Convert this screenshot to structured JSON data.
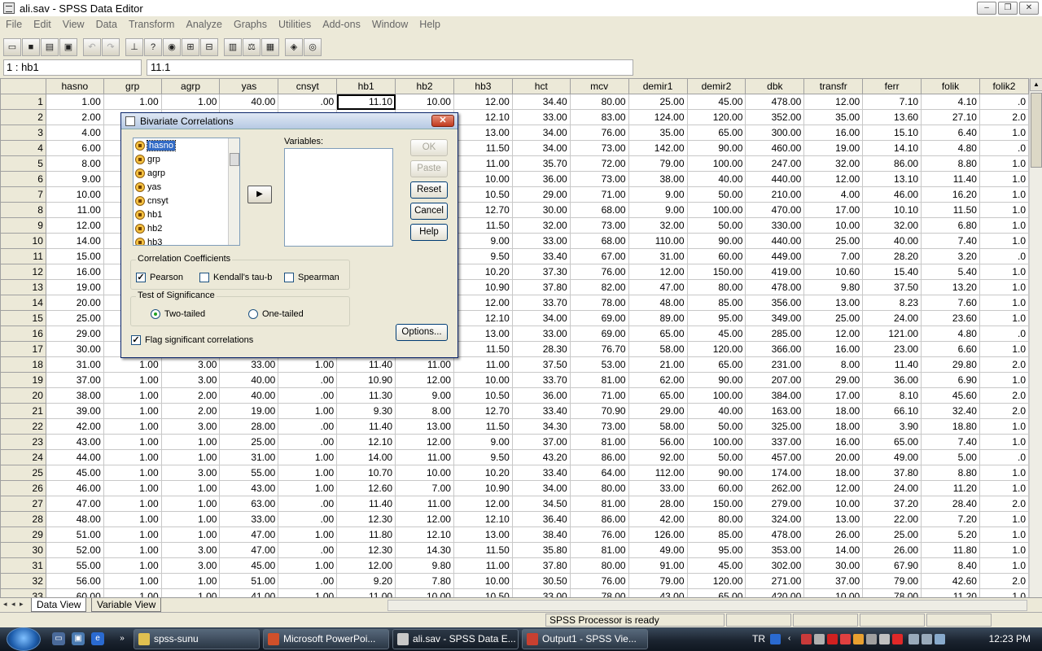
{
  "window": {
    "title": "ali.sav - SPSS Data Editor",
    "buttons": [
      "–",
      "❐",
      "✕"
    ]
  },
  "menu": [
    "File",
    "Edit",
    "View",
    "Data",
    "Transform",
    "Analyze",
    "Graphs",
    "Utilities",
    "Add-ons",
    "Window",
    "Help"
  ],
  "toolbar": {
    "icons": [
      "open-icon",
      "save-icon",
      "print-icon",
      "dialog-recall-icon",
      "undo-icon",
      "redo-icon",
      "goto-case-icon",
      "variables-icon",
      "find-icon",
      "insert-cases-icon",
      "insert-variable-icon",
      "split-file-icon",
      "weight-cases-icon",
      "select-cases-icon",
      "value-labels-icon",
      "use-sets-icon"
    ]
  },
  "cell_editor": {
    "ref": "1 : hb1",
    "value": "11.1"
  },
  "grid": {
    "columns": [
      "hasno",
      "grp",
      "agrp",
      "yas",
      "cnsyt",
      "hb1",
      "hb2",
      "hb3",
      "hct",
      "mcv",
      "demir1",
      "demir2",
      "dbk",
      "transfr",
      "ferr",
      "folik",
      "folik2"
    ],
    "rows": [
      [
        "1",
        "1.00",
        "1.00",
        "1.00",
        "40.00",
        ".00",
        "11.10",
        "10.00",
        "12.00",
        "34.40",
        "80.00",
        "25.00",
        "45.00",
        "478.00",
        "12.00",
        "7.10",
        "4.10",
        ".0"
      ],
      [
        "2",
        "2.00",
        "",
        "",
        "",
        "",
        "",
        "",
        "12.10",
        "33.00",
        "83.00",
        "124.00",
        "120.00",
        "352.00",
        "35.00",
        "13.60",
        "27.10",
        "2.0"
      ],
      [
        "3",
        "4.00",
        "",
        "",
        "",
        "",
        "",
        "",
        "13.00",
        "34.00",
        "76.00",
        "35.00",
        "65.00",
        "300.00",
        "16.00",
        "15.10",
        "6.40",
        "1.0"
      ],
      [
        "4",
        "6.00",
        "",
        "",
        "",
        "",
        "",
        "",
        "11.50",
        "34.00",
        "73.00",
        "142.00",
        "90.00",
        "460.00",
        "19.00",
        "14.10",
        "4.80",
        ".0"
      ],
      [
        "5",
        "8.00",
        "",
        "",
        "",
        "",
        "",
        "",
        "11.00",
        "35.70",
        "72.00",
        "79.00",
        "100.00",
        "247.00",
        "32.00",
        "86.00",
        "8.80",
        "1.0"
      ],
      [
        "6",
        "9.00",
        "",
        "",
        "",
        "",
        "",
        "",
        "10.00",
        "36.00",
        "73.00",
        "38.00",
        "40.00",
        "440.00",
        "12.00",
        "13.10",
        "11.40",
        "1.0"
      ],
      [
        "7",
        "10.00",
        "",
        "",
        "",
        "",
        "",
        "",
        "10.50",
        "29.00",
        "71.00",
        "9.00",
        "50.00",
        "210.00",
        "4.00",
        "46.00",
        "16.20",
        "1.0"
      ],
      [
        "8",
        "11.00",
        "",
        "",
        "",
        "",
        "",
        "",
        "12.70",
        "30.00",
        "68.00",
        "9.00",
        "100.00",
        "470.00",
        "17.00",
        "10.10",
        "11.50",
        "1.0"
      ],
      [
        "9",
        "12.00",
        "",
        "",
        "",
        "",
        "",
        "",
        "11.50",
        "32.00",
        "73.00",
        "32.00",
        "50.00",
        "330.00",
        "10.00",
        "32.00",
        "6.80",
        "1.0"
      ],
      [
        "10",
        "14.00",
        "",
        "",
        "",
        "",
        "",
        "",
        "9.00",
        "33.00",
        "68.00",
        "110.00",
        "90.00",
        "440.00",
        "25.00",
        "40.00",
        "7.40",
        "1.0"
      ],
      [
        "11",
        "15.00",
        "",
        "",
        "",
        "",
        "",
        "",
        "9.50",
        "33.40",
        "67.00",
        "31.00",
        "60.00",
        "449.00",
        "7.00",
        "28.20",
        "3.20",
        ".0"
      ],
      [
        "12",
        "16.00",
        "",
        "",
        "",
        "",
        "",
        "",
        "10.20",
        "37.30",
        "76.00",
        "12.00",
        "150.00",
        "419.00",
        "10.60",
        "15.40",
        "5.40",
        "1.0"
      ],
      [
        "13",
        "19.00",
        "",
        "",
        "",
        "",
        "",
        "",
        "10.90",
        "37.80",
        "82.00",
        "47.00",
        "80.00",
        "478.00",
        "9.80",
        "37.50",
        "13.20",
        "1.0"
      ],
      [
        "14",
        "20.00",
        "",
        "",
        "",
        "",
        "",
        "",
        "12.00",
        "33.70",
        "78.00",
        "48.00",
        "85.00",
        "356.00",
        "13.00",
        "8.23",
        "7.60",
        "1.0"
      ],
      [
        "15",
        "25.00",
        "",
        "",
        "",
        "",
        "",
        "",
        "12.10",
        "34.00",
        "69.00",
        "89.00",
        "95.00",
        "349.00",
        "25.00",
        "24.00",
        "23.60",
        "1.0"
      ],
      [
        "16",
        "29.00",
        "",
        "",
        "",
        "",
        "",
        "",
        "13.00",
        "33.00",
        "69.00",
        "65.00",
        "45.00",
        "285.00",
        "12.00",
        "121.00",
        "4.80",
        ".0"
      ],
      [
        "17",
        "30.00",
        "",
        "",
        "",
        "",
        "",
        "",
        "11.50",
        "28.30",
        "76.70",
        "58.00",
        "120.00",
        "366.00",
        "16.00",
        "23.00",
        "6.60",
        "1.0"
      ],
      [
        "18",
        "31.00",
        "1.00",
        "3.00",
        "33.00",
        "1.00",
        "11.40",
        "11.00",
        "11.00",
        "37.50",
        "53.00",
        "21.00",
        "65.00",
        "231.00",
        "8.00",
        "11.40",
        "29.80",
        "2.0"
      ],
      [
        "19",
        "37.00",
        "1.00",
        "3.00",
        "40.00",
        ".00",
        "10.90",
        "12.00",
        "10.00",
        "33.70",
        "81.00",
        "62.00",
        "90.00",
        "207.00",
        "29.00",
        "36.00",
        "6.90",
        "1.0"
      ],
      [
        "20",
        "38.00",
        "1.00",
        "2.00",
        "40.00",
        ".00",
        "11.30",
        "9.00",
        "10.50",
        "36.00",
        "71.00",
        "65.00",
        "100.00",
        "384.00",
        "17.00",
        "8.10",
        "45.60",
        "2.0"
      ],
      [
        "21",
        "39.00",
        "1.00",
        "2.00",
        "19.00",
        "1.00",
        "9.30",
        "8.00",
        "12.70",
        "33.40",
        "70.90",
        "29.00",
        "40.00",
        "163.00",
        "18.00",
        "66.10",
        "32.40",
        "2.0"
      ],
      [
        "22",
        "42.00",
        "1.00",
        "3.00",
        "28.00",
        ".00",
        "11.40",
        "13.00",
        "11.50",
        "34.30",
        "73.00",
        "58.00",
        "50.00",
        "325.00",
        "18.00",
        "3.90",
        "18.80",
        "1.0"
      ],
      [
        "23",
        "43.00",
        "1.00",
        "1.00",
        "25.00",
        ".00",
        "12.10",
        "12.00",
        "9.00",
        "37.00",
        "81.00",
        "56.00",
        "100.00",
        "337.00",
        "16.00",
        "65.00",
        "7.40",
        "1.0"
      ],
      [
        "24",
        "44.00",
        "1.00",
        "1.00",
        "31.00",
        "1.00",
        "14.00",
        "11.00",
        "9.50",
        "43.20",
        "86.00",
        "92.00",
        "50.00",
        "457.00",
        "20.00",
        "49.00",
        "5.00",
        ".0"
      ],
      [
        "25",
        "45.00",
        "1.00",
        "3.00",
        "55.00",
        "1.00",
        "10.70",
        "10.00",
        "10.20",
        "33.40",
        "64.00",
        "112.00",
        "90.00",
        "174.00",
        "18.00",
        "37.80",
        "8.80",
        "1.0"
      ],
      [
        "26",
        "46.00",
        "1.00",
        "1.00",
        "43.00",
        "1.00",
        "12.60",
        "7.00",
        "10.90",
        "34.00",
        "80.00",
        "33.00",
        "60.00",
        "262.00",
        "12.00",
        "24.00",
        "11.20",
        "1.0"
      ],
      [
        "27",
        "47.00",
        "1.00",
        "1.00",
        "63.00",
        ".00",
        "11.40",
        "11.00",
        "12.00",
        "34.50",
        "81.00",
        "28.00",
        "150.00",
        "279.00",
        "10.00",
        "37.20",
        "28.40",
        "2.0"
      ],
      [
        "28",
        "48.00",
        "1.00",
        "1.00",
        "33.00",
        ".00",
        "12.30",
        "12.00",
        "12.10",
        "36.40",
        "86.00",
        "42.00",
        "80.00",
        "324.00",
        "13.00",
        "22.00",
        "7.20",
        "1.0"
      ],
      [
        "29",
        "51.00",
        "1.00",
        "1.00",
        "47.00",
        "1.00",
        "11.80",
        "12.10",
        "13.00",
        "38.40",
        "76.00",
        "126.00",
        "85.00",
        "478.00",
        "26.00",
        "25.00",
        "5.20",
        "1.0"
      ],
      [
        "30",
        "52.00",
        "1.00",
        "3.00",
        "47.00",
        ".00",
        "12.30",
        "14.30",
        "11.50",
        "35.80",
        "81.00",
        "49.00",
        "95.00",
        "353.00",
        "14.00",
        "26.00",
        "11.80",
        "1.0"
      ],
      [
        "31",
        "55.00",
        "1.00",
        "3.00",
        "45.00",
        "1.00",
        "12.00",
        "9.80",
        "11.00",
        "37.80",
        "80.00",
        "91.00",
        "45.00",
        "302.00",
        "30.00",
        "67.90",
        "8.40",
        "1.0"
      ],
      [
        "32",
        "56.00",
        "1.00",
        "1.00",
        "51.00",
        ".00",
        "9.20",
        "7.80",
        "10.00",
        "30.50",
        "76.00",
        "79.00",
        "120.00",
        "271.00",
        "37.00",
        "79.00",
        "42.60",
        "2.0"
      ],
      [
        "33",
        "60.00",
        "1.00",
        "1.00",
        "41.00",
        "1.00",
        "11.00",
        "10.00",
        "10.50",
        "33.00",
        "78.00",
        "43.00",
        "65.00",
        "420.00",
        "10.00",
        "78.00",
        "11.20",
        "1.0"
      ]
    ]
  },
  "tabs": {
    "data_view": "Data View",
    "variable_view": "Variable View"
  },
  "status": {
    "processor": "SPSS Processor  is ready"
  },
  "dialog": {
    "title": "Bivariate Correlations",
    "source_vars": [
      "hasno",
      "grp",
      "agrp",
      "yas",
      "cnsyt",
      "hb1",
      "hb2",
      "hb3"
    ],
    "variables_label": "Variables:",
    "buttons": {
      "ok": "OK",
      "paste": "Paste",
      "reset": "Reset",
      "cancel": "Cancel",
      "help": "Help",
      "options": "Options..."
    },
    "coeff_group": "Correlation Coefficients",
    "pearson": "Pearson",
    "kendall": "Kendall's tau-b",
    "spearman": "Spearman",
    "sig_group": "Test of Significance",
    "two_tailed": "Two-tailed",
    "one_tailed": "One-tailed",
    "flag": "Flag significant correlations"
  },
  "taskbar": {
    "tasks": [
      "spss-sunu",
      "Microsoft PowerPoi...",
      "ali.sav - SPSS Data E...",
      "Output1 - SPSS Vie..."
    ],
    "lang": "TR",
    "clock": "12:23 PM"
  },
  "colors": {
    "selection": "#316ac5",
    "dialog_border": "#0a246a",
    "grid_header": "#ece9d8"
  }
}
